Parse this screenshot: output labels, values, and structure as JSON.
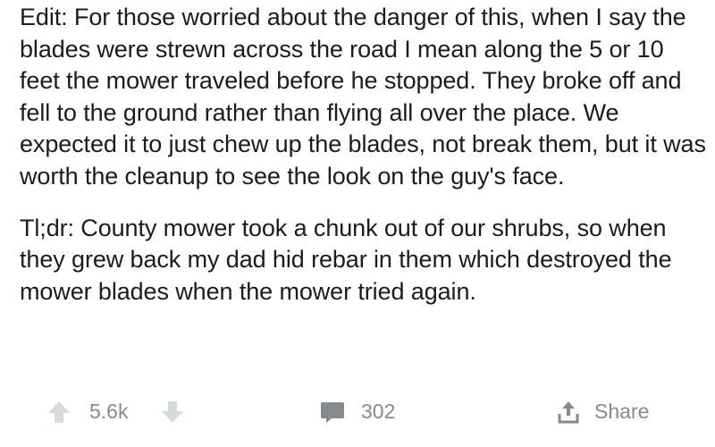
{
  "post": {
    "paragraphs": [
      "Edit: For those worried about the danger of this, when I say the blades were strewn across the road I mean along the 5 or 10 feet the mower traveled before he stopped. They broke off and fell to the ground rather than flying all over the place. We expected it to just chew up the blades, not break them, but it was worth the cleanup to see the look on the guy's face.",
      "Tl;dr: County mower took a chunk out of our shrubs, so when they grew back my dad hid rebar in them which destroyed the mower blades when the mower tried again."
    ]
  },
  "actions": {
    "upvote_icon": "arrow-up-icon",
    "score": "5.6k",
    "downvote_icon": "arrow-down-icon",
    "comment_icon": "speech-bubble-icon",
    "comment_count": "302",
    "share_icon": "share-upload-icon",
    "share_label": "Share"
  },
  "colors": {
    "text": "#1c1c1c",
    "muted": "#878a8c",
    "background": "#ffffff"
  }
}
